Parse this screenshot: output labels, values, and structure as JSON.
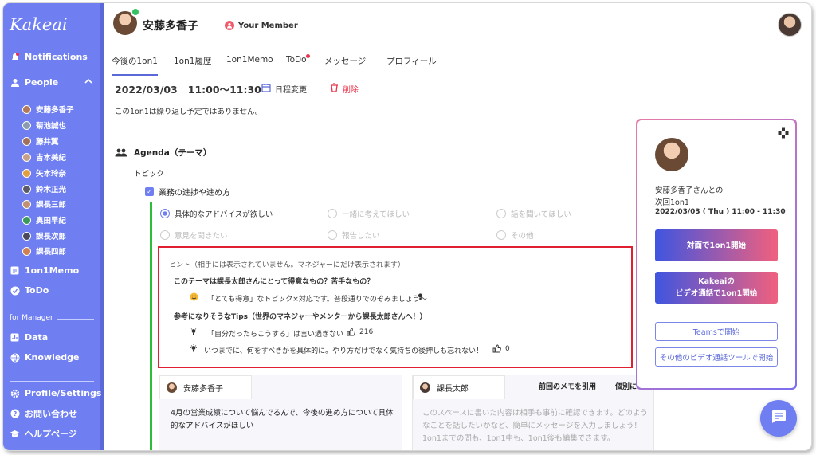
{
  "app": {
    "logo": "Kakeai"
  },
  "sidebar": {
    "notifications": "Notifications",
    "people": "People",
    "people_list": [
      "安藤多香子",
      "菊池誠也",
      "藤井翼",
      "吉本美紀",
      "矢本玲奈",
      "鈴木正光",
      "課長三郎",
      "奥田早紀",
      "課長次郎",
      "課長四郎"
    ],
    "one_on_one_memo": "1on1Memo",
    "todo": "ToDo",
    "for_manager": "for Manager",
    "data": "Data",
    "knowledge": "Knowledge",
    "profile_settings": "Profile/Settings",
    "contact": "お問い合わせ",
    "help": "ヘルプページ"
  },
  "header": {
    "name": "安藤多香子",
    "member_label": "Your Member"
  },
  "tabs": [
    "今後の1on1",
    "1on1履歴",
    "1on1Memo",
    "ToDo",
    "メッセージ",
    "プロフィール"
  ],
  "meeting": {
    "date": "2022/03/03",
    "time": "11:00〜11:30",
    "reschedule": "日程変更",
    "delete": "削除",
    "repeat_note": "この1on1は繰り返し予定ではありません。"
  },
  "agenda": {
    "title": "Agenda（テーマ）",
    "topic_label": "トピック",
    "topic": "業務の進捗や進め方",
    "options": [
      "具体的なアドバイスが欲しい",
      "一緒に考えてほしい",
      "話を聞いてほしい",
      "意見を聞きたい",
      "報告したい",
      "その他"
    ],
    "selected_index": 0
  },
  "hint": {
    "header": "ヒント（相手には表示されていません。マネジャーにだけ表示されます）",
    "q": "このテーマは課長太郎さんにとって得意なもの？苦手なもの？",
    "answer": "「とても得意」なトピック×対応です。普段通りでのぞみましょう〜",
    "tips_title": "参考になりそうなTips（世界のマネジャーやメンターから課長太郎さんへ！）",
    "tips": [
      {
        "text": "「自分だったらこうする」は言い過ぎない",
        "likes": "216"
      },
      {
        "text": "いつまでに、何をすべきかを具体的に。やり方だけでなく気持ちの後押しも忘れない！",
        "likes": "0"
      }
    ]
  },
  "notes": {
    "member_name": "安藤多香子",
    "member_text": "4月の営業成績について悩んでるんで、今後の進め方について具体的なアドバイスがほしい",
    "manager_name": "課長太郎",
    "manager_placeholder": "このスペースに書いた内容は相手も事前に確認できます。どのようなことを話したいかなど、簡単にメッセージを入力しましょう！1on1までの間も、1on1中も、1on1後も編集できます。",
    "prev_memo": "前回のメモを引用",
    "individual": "個別に"
  },
  "panel": {
    "with_label": "安藤多香子さんとの",
    "next_label": "次回1on1",
    "datetime": "2022/03/03 ( Thu ) 11:00 - 11:30",
    "btn_face": "対面で1on1開始",
    "btn_video_line1": "Kakeaiの",
    "btn_video_line2": "ビデオ通話で1on1開始",
    "btn_teams": "Teamsで開始",
    "btn_other": "その他のビデオ通話ツールで開始"
  },
  "colors": {
    "sidebar": "#6f7ff2",
    "accent": "#5a68d8",
    "hint_border": "#e02030",
    "green": "#2cbd3a"
  }
}
